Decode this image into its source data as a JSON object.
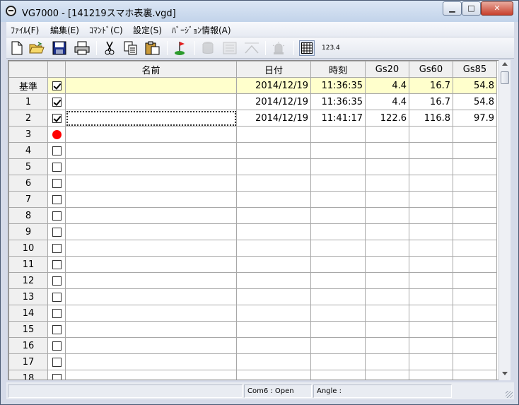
{
  "window": {
    "title": "VG7000 - [141219スマホ表裏.vgd]"
  },
  "menubar": {
    "items": [
      {
        "label": "ﾌｧｲﾙ(F)"
      },
      {
        "label": "編集(E)"
      },
      {
        "label": "ｺﾏﾝﾄﾞ(C)"
      },
      {
        "label": "設定(S)"
      },
      {
        "label": "ﾊﾞｰｼﾞｮﾝ情報(A)"
      }
    ]
  },
  "toolbar": {
    "display_format_label": "123.4"
  },
  "grid": {
    "columns": [
      "名前",
      "日付",
      "時刻",
      "Gs20",
      "Gs60",
      "Gs85"
    ],
    "rows": [
      {
        "label": "基準",
        "mark": "checked",
        "name": "",
        "date": "2014/12/19",
        "time": "11:36:35",
        "gs20": "4.4",
        "gs60": "16.7",
        "gs85": "54.8"
      },
      {
        "label": "1",
        "mark": "checked",
        "name": "",
        "date": "2014/12/19",
        "time": "11:36:35",
        "gs20": "4.4",
        "gs60": "16.7",
        "gs85": "54.8"
      },
      {
        "label": "2",
        "mark": "checked",
        "name": "",
        "date": "2014/12/19",
        "time": "11:41:17",
        "gs20": "122.6",
        "gs60": "116.8",
        "gs85": "97.9"
      },
      {
        "label": "3",
        "mark": "current",
        "name": "",
        "date": "",
        "time": "",
        "gs20": "",
        "gs60": "",
        "gs85": ""
      },
      {
        "label": "4",
        "mark": "unchecked",
        "name": "",
        "date": "",
        "time": "",
        "gs20": "",
        "gs60": "",
        "gs85": ""
      },
      {
        "label": "5",
        "mark": "unchecked",
        "name": "",
        "date": "",
        "time": "",
        "gs20": "",
        "gs60": "",
        "gs85": ""
      },
      {
        "label": "6",
        "mark": "unchecked",
        "name": "",
        "date": "",
        "time": "",
        "gs20": "",
        "gs60": "",
        "gs85": ""
      },
      {
        "label": "7",
        "mark": "unchecked",
        "name": "",
        "date": "",
        "time": "",
        "gs20": "",
        "gs60": "",
        "gs85": ""
      },
      {
        "label": "8",
        "mark": "unchecked",
        "name": "",
        "date": "",
        "time": "",
        "gs20": "",
        "gs60": "",
        "gs85": ""
      },
      {
        "label": "9",
        "mark": "unchecked",
        "name": "",
        "date": "",
        "time": "",
        "gs20": "",
        "gs60": "",
        "gs85": ""
      },
      {
        "label": "10",
        "mark": "unchecked",
        "name": "",
        "date": "",
        "time": "",
        "gs20": "",
        "gs60": "",
        "gs85": ""
      },
      {
        "label": "11",
        "mark": "unchecked",
        "name": "",
        "date": "",
        "time": "",
        "gs20": "",
        "gs60": "",
        "gs85": ""
      },
      {
        "label": "12",
        "mark": "unchecked",
        "name": "",
        "date": "",
        "time": "",
        "gs20": "",
        "gs60": "",
        "gs85": ""
      },
      {
        "label": "13",
        "mark": "unchecked",
        "name": "",
        "date": "",
        "time": "",
        "gs20": "",
        "gs60": "",
        "gs85": ""
      },
      {
        "label": "14",
        "mark": "unchecked",
        "name": "",
        "date": "",
        "time": "",
        "gs20": "",
        "gs60": "",
        "gs85": ""
      },
      {
        "label": "15",
        "mark": "unchecked",
        "name": "",
        "date": "",
        "time": "",
        "gs20": "",
        "gs60": "",
        "gs85": ""
      },
      {
        "label": "16",
        "mark": "unchecked",
        "name": "",
        "date": "",
        "time": "",
        "gs20": "",
        "gs60": "",
        "gs85": ""
      },
      {
        "label": "17",
        "mark": "unchecked",
        "name": "",
        "date": "",
        "time": "",
        "gs20": "",
        "gs60": "",
        "gs85": ""
      },
      {
        "label": "18",
        "mark": "unchecked",
        "name": "",
        "date": "",
        "time": "",
        "gs20": "",
        "gs60": "",
        "gs85": ""
      }
    ]
  },
  "statusbar": {
    "port": "Com6 : Open",
    "angle": "Angle :"
  },
  "colors": {
    "reference_row": "#ffffcc",
    "current_marker": "#ff0000"
  }
}
